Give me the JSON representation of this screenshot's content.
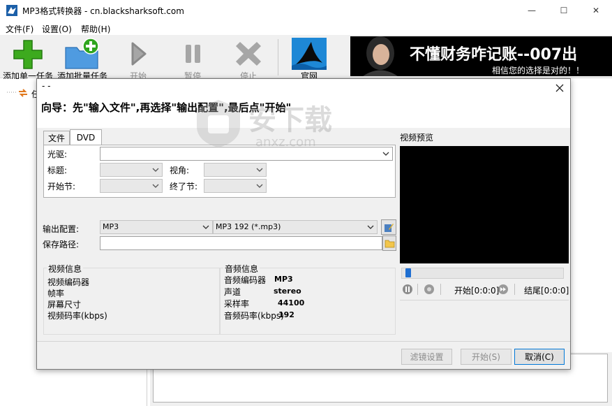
{
  "window": {
    "title": "MP3格式转换器 - cn.blacksharksoft.com",
    "caption_buttons": {
      "minimize": "—",
      "maximize": "☐",
      "close": "✕"
    }
  },
  "menu": [
    "文件(F)",
    "设置(O)",
    "帮助(H)"
  ],
  "toolbar": {
    "add_single": "添加单一任务",
    "add_batch": "添加批量任务",
    "start": "开始",
    "pause": "暂停",
    "stop": "停止",
    "website": "官网"
  },
  "banner": {
    "headline": "不懂财务咋记账--007出",
    "sub": "相信您的选择是对的！！"
  },
  "tree": {
    "root_label": "任"
  },
  "dialog": {
    "title": "- -",
    "guide": "向导：先\"输入文件\",再选择\"输出配置\",最后点\"开始\"",
    "tabs": [
      "文件",
      "DVD"
    ],
    "dvd": {
      "drive_label": "光驱:",
      "drive_value": "",
      "title_label": "标题:",
      "angle_label": "视角:",
      "start_chapter_label": "开始节:",
      "end_chapter_label": "终了节:"
    },
    "output": {
      "config_label": "输出配置:",
      "format_value": "MP3",
      "preset_value": "MP3 192 (*.mp3)",
      "save_label": "保存路径:",
      "save_value": ""
    },
    "video_info": {
      "title": "视频信息",
      "rows": [
        "视频编码器",
        "帧率",
        "屏幕尺寸",
        "视频码率(kbps)"
      ]
    },
    "audio_info": {
      "title": "音频信息",
      "rows": [
        {
          "k": "音频编码器",
          "v": "MP3"
        },
        {
          "k": "声道",
          "v": "stereo"
        },
        {
          "k": "采样率",
          "v": "44100"
        },
        {
          "k": "音频码率(kbps)",
          "v": "192"
        }
      ]
    },
    "preview": {
      "label": "视频预览",
      "start": "开始[0:0:0]",
      "end": "结尾[0:0:0]",
      "seek_fraction": 0.02
    },
    "buttons": {
      "filter": "滤镜设置",
      "start": "开始(S)",
      "cancel": "取消(C)"
    }
  },
  "watermark": {
    "text": "安下载",
    "sub": "anxz.com"
  },
  "colors": {
    "accent": "#0078d7",
    "preview_bg": "#000000",
    "banner_bg": "#000000"
  }
}
